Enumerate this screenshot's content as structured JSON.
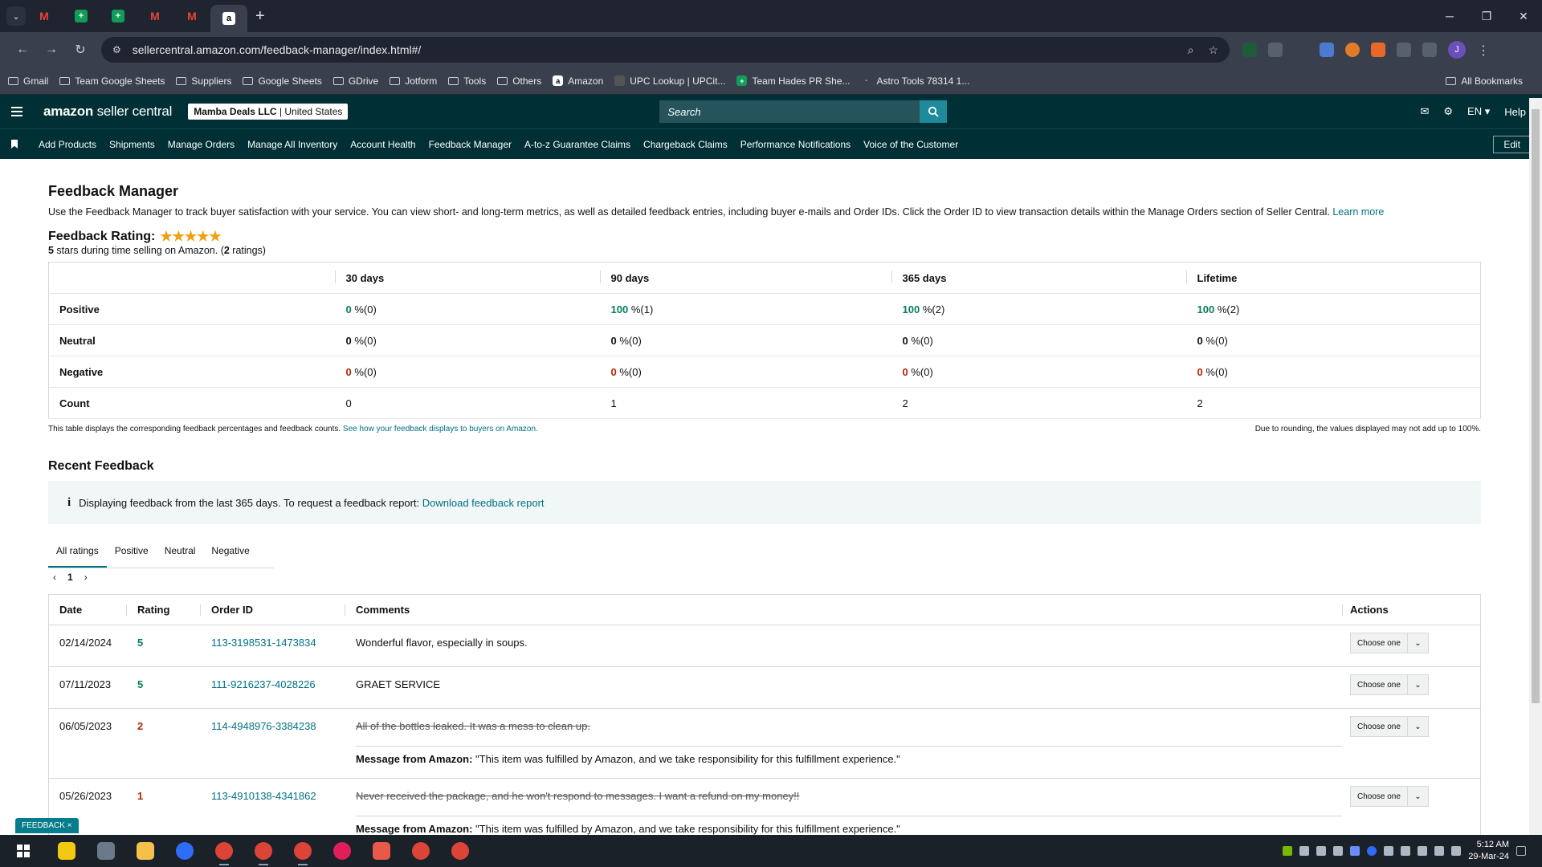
{
  "browser": {
    "url": "sellercentral.amazon.com/feedback-manager/index.html#/",
    "bookmarks": [
      "Gmail",
      "Team Google Sheets",
      "Suppliers",
      "Google Sheets",
      "GDrive",
      "Jotform",
      "Tools",
      "Others",
      "Amazon",
      "UPC Lookup | UPCit...",
      "Team Hades PR She...",
      "Astro Tools 78314 1..."
    ],
    "all_bookmarks": "All Bookmarks",
    "profile_initial": "J"
  },
  "header": {
    "logo_bold": "amazon",
    "logo_rest": " seller central",
    "account_bold": "Mamba Deals LLC",
    "account_rest": " | United States",
    "search_placeholder": "Search",
    "language": "EN",
    "help": "Help"
  },
  "nav": {
    "items": [
      "Add Products",
      "Shipments",
      "Manage Orders",
      "Manage All Inventory",
      "Account Health",
      "Feedback Manager",
      "A-to-z Guarantee Claims",
      "Chargeback Claims",
      "Performance Notifications",
      "Voice of the Customer"
    ],
    "edit": "Edit"
  },
  "page": {
    "title": "Feedback Manager",
    "description": "Use the Feedback Manager to track buyer satisfaction with your service. You can view short- and long-term metrics, as well as detailed feedback entries, including buyer e-mails and Order IDs. Click the Order ID to view transaction details within the Manage Orders section of Seller Central.",
    "learn_more": "Learn more",
    "rating_label": "Feedback Rating:",
    "stars": "★★★★★",
    "rating_stars": "5",
    "rating_mid": " stars during time selling on Amazon. (",
    "rating_count": "2",
    "rating_end": " ratings)"
  },
  "metrics": {
    "columns": [
      "30 days",
      "90 days",
      "365 days",
      "Lifetime"
    ],
    "rows": [
      {
        "label": "Positive",
        "values": [
          "0",
          "100",
          "100",
          "100"
        ],
        "counts": [
          "%(0)",
          "%(1)",
          "%(2)",
          "%(2)"
        ]
      },
      {
        "label": "Neutral",
        "values": [
          "0",
          "0",
          "0",
          "0"
        ],
        "counts": [
          "%(0)",
          "%(0)",
          "%(0)",
          "%(0)"
        ]
      },
      {
        "label": "Negative",
        "values": [
          "0",
          "0",
          "0",
          "0"
        ],
        "counts": [
          "%(0)",
          "%(0)",
          "%(0)",
          "%(0)"
        ]
      },
      {
        "label": "Count",
        "values": [
          "0",
          "1",
          "2",
          "2"
        ]
      }
    ],
    "note_left": "This table displays the corresponding feedback percentages and feedback counts.",
    "note_link": "See how your feedback displays to buyers on Amazon.",
    "note_right": "Due to rounding, the values displayed may not add up to 100%."
  },
  "recent": {
    "title": "Recent Feedback",
    "info": "Displaying feedback from the last 365 days. To request a feedback report:",
    "info_link": "Download feedback report",
    "tabs": [
      "All ratings",
      "Positive",
      "Neutral",
      "Negative"
    ],
    "page": "1",
    "headers": [
      "Date",
      "Rating",
      "Order ID",
      "Comments",
      "Actions"
    ],
    "rows": [
      {
        "date": "02/14/2024",
        "rating": "5",
        "order": "113-3198531-1473834",
        "comment": "Wonderful flavor, especially in soups.",
        "action": "Choose one"
      },
      {
        "date": "07/11/2023",
        "rating": "5",
        "order": "111-9216237-4028226",
        "comment": "GRAET SERVICE",
        "action": "Choose one"
      },
      {
        "date": "06/05/2023",
        "rating": "2",
        "order": "114-4948976-3384238",
        "comment": "All of the bottles leaked. It was a mess to clean up.",
        "msg_label": "Message from Amazon:",
        "msg": " \"This item was fulfilled by Amazon, and we take responsibility for this fulfillment experience.\"",
        "action": "Choose one"
      },
      {
        "date": "05/26/2023",
        "rating": "1",
        "order": "113-4910138-4341862",
        "comment": "Never received the package, and he won't respond to messages. I want a refund on my money!!",
        "msg_label": "Message from Amazon:",
        "msg": " \"This item was fulfilled by Amazon, and we take responsibility for this fulfillment experience.\"",
        "action": "Choose one"
      }
    ]
  },
  "feedback_tab": "FEEDBACK ×",
  "taskbar": {
    "time": "5:12 AM",
    "date": "29-Mar-24"
  }
}
